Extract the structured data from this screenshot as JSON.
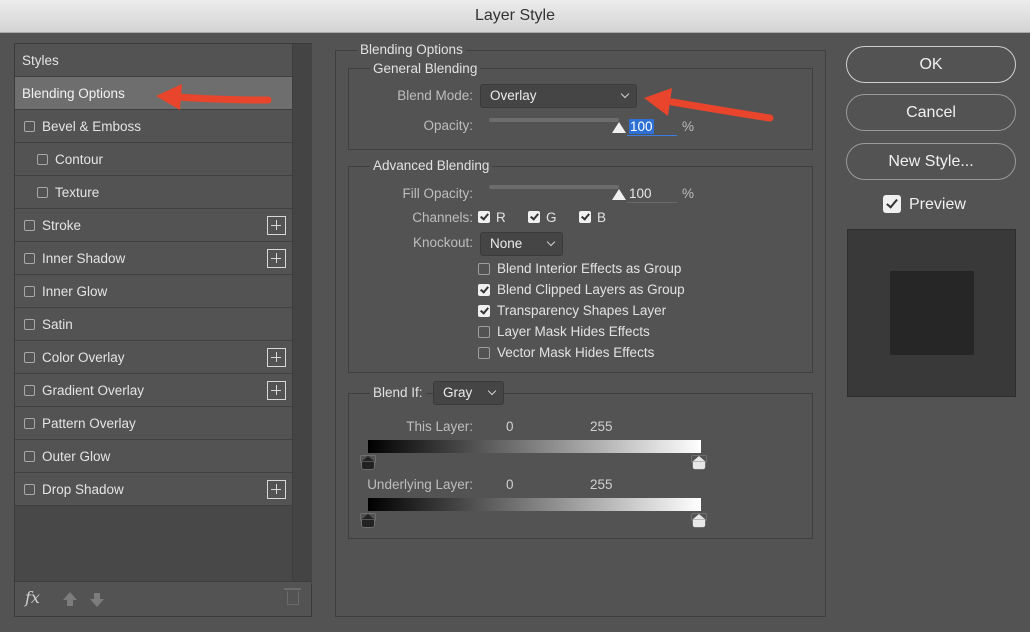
{
  "window": {
    "title": "Layer Style"
  },
  "styles_panel": {
    "items": [
      {
        "label": "Styles",
        "type": "header"
      },
      {
        "label": "Blending Options",
        "type": "selected"
      },
      {
        "label": "Bevel & Emboss",
        "checkbox": true,
        "plus": false,
        "indent": 0
      },
      {
        "label": "Contour",
        "checkbox": true,
        "plus": false,
        "indent": 1
      },
      {
        "label": "Texture",
        "checkbox": true,
        "plus": false,
        "indent": 1
      },
      {
        "label": "Stroke",
        "checkbox": true,
        "plus": true,
        "indent": 0
      },
      {
        "label": "Inner Shadow",
        "checkbox": true,
        "plus": true,
        "indent": 0
      },
      {
        "label": "Inner Glow",
        "checkbox": true,
        "plus": false,
        "indent": 0
      },
      {
        "label": "Satin",
        "checkbox": true,
        "plus": false,
        "indent": 0
      },
      {
        "label": "Color Overlay",
        "checkbox": true,
        "plus": true,
        "indent": 0
      },
      {
        "label": "Gradient Overlay",
        "checkbox": true,
        "plus": true,
        "indent": 0
      },
      {
        "label": "Pattern Overlay",
        "checkbox": true,
        "plus": false,
        "indent": 0
      },
      {
        "label": "Outer Glow",
        "checkbox": true,
        "plus": false,
        "indent": 0
      },
      {
        "label": "Drop Shadow",
        "checkbox": true,
        "plus": true,
        "indent": 0
      }
    ],
    "footer": {
      "fx_label": "fx",
      "icons": [
        "fx-icon",
        "move-up-icon",
        "move-down-icon",
        "trash-icon"
      ]
    }
  },
  "blending": {
    "title": "Blending Options",
    "general": {
      "title": "General Blending",
      "blend_mode_label": "Blend Mode:",
      "blend_mode_value": "Overlay",
      "opacity_label": "Opacity:",
      "opacity_value": "100",
      "opacity_fraction": 1.0,
      "percent": "%"
    },
    "advanced": {
      "title": "Advanced Blending",
      "fill_opacity_label": "Fill Opacity:",
      "fill_opacity_value": "100",
      "fill_opacity_fraction": 1.0,
      "percent": "%",
      "channels_label": "Channels:",
      "channels": [
        {
          "label": "R",
          "checked": true
        },
        {
          "label": "G",
          "checked": true
        },
        {
          "label": "B",
          "checked": true
        }
      ],
      "knockout_label": "Knockout:",
      "knockout_value": "None",
      "options": [
        {
          "label": "Blend Interior Effects as Group",
          "checked": false
        },
        {
          "label": "Blend Clipped Layers as Group",
          "checked": true
        },
        {
          "label": "Transparency Shapes Layer",
          "checked": true
        },
        {
          "label": "Layer Mask Hides Effects",
          "checked": false
        },
        {
          "label": "Vector Mask Hides Effects",
          "checked": false
        }
      ]
    },
    "blend_if": {
      "label": "Blend If:",
      "value": "Gray",
      "this_layer": {
        "label": "This Layer:",
        "min": "0",
        "max": "255"
      },
      "underlying_layer": {
        "label": "Underlying Layer:",
        "min": "0",
        "max": "255"
      }
    }
  },
  "buttons": {
    "ok": "OK",
    "cancel": "Cancel",
    "new_style": "New Style..."
  },
  "preview": {
    "label": "Preview",
    "checked": true
  },
  "colors": {
    "annotation_arrow": "#e8452c",
    "selection": "#2d6fd3"
  }
}
